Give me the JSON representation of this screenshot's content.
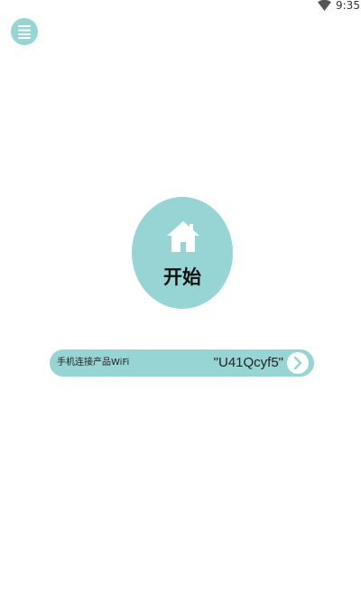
{
  "status_bar": {
    "time": "9:35",
    "wifi_icon": "wifi-signal-icon"
  },
  "header": {
    "menu_icon": "menu-icon"
  },
  "start": {
    "icon": "home-icon",
    "label": "开始"
  },
  "wifi": {
    "label": "手机连接产品WiFi",
    "ssid": "\"U41Qcyf5\"",
    "arrow_icon": "chevron-right-icon"
  },
  "colors": {
    "accent": "#97d4d4",
    "background": "#ffffff"
  }
}
